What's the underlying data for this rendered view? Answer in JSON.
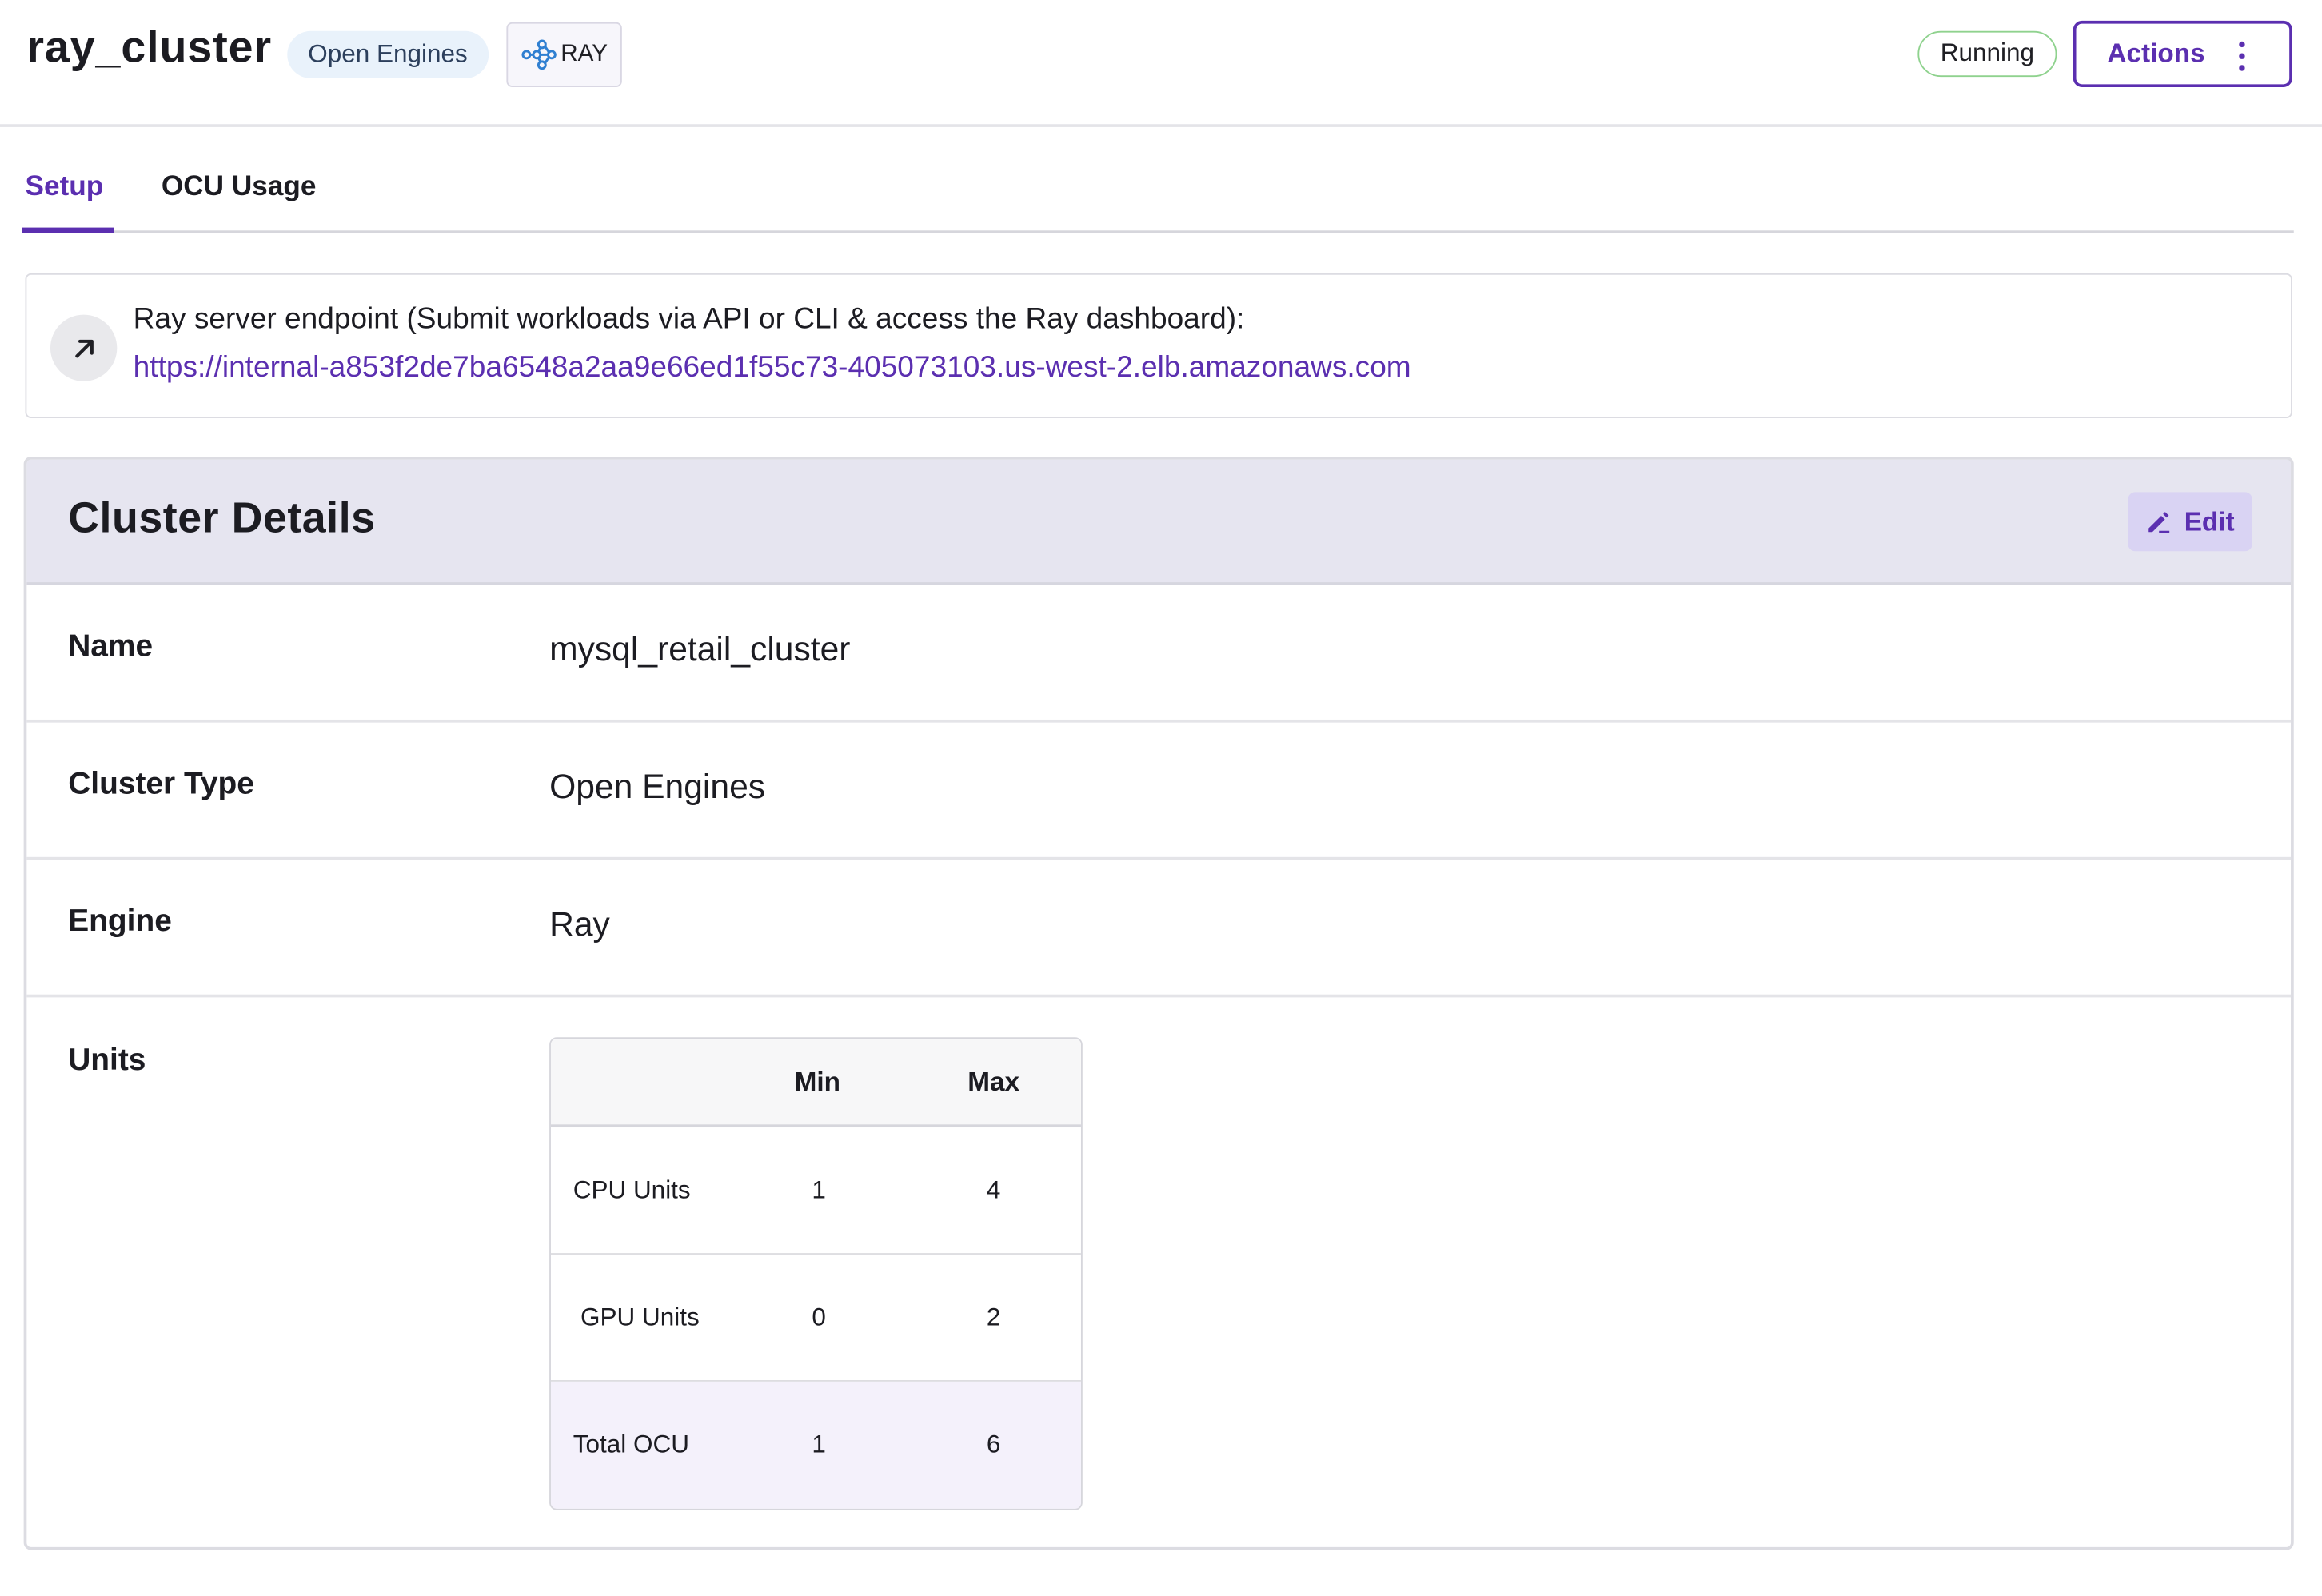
{
  "header": {
    "title": "ray_cluster",
    "cluster_type_badge": "Open Engines",
    "engine_badge": "RAY",
    "status": "Running",
    "actions_label": "Actions"
  },
  "tabs": [
    {
      "label": "Setup",
      "active": true
    },
    {
      "label": "OCU Usage",
      "active": false
    }
  ],
  "endpoint": {
    "label": "Ray server endpoint (Submit workloads via API or CLI & access the Ray dashboard):",
    "url": "https://internal-a853f2de7ba6548a2aa9e66ed1f55c73-405073103.us-west-2.elb.amazonaws.com"
  },
  "cluster_details": {
    "title": "Cluster Details",
    "edit_label": "Edit",
    "rows": [
      {
        "label": "Name",
        "value": "mysql_retail_cluster"
      },
      {
        "label": "Cluster Type",
        "value": "Open Engines"
      },
      {
        "label": "Engine",
        "value": "Ray"
      },
      {
        "label": "Units"
      }
    ]
  },
  "units_table": {
    "columns": [
      "",
      "Min",
      "Max"
    ],
    "rows": [
      {
        "label": "CPU Units",
        "min": "1",
        "max": "4"
      },
      {
        "label": "GPU Units",
        "min": "0",
        "max": "2"
      },
      {
        "label": "Total OCU",
        "min": "1",
        "max": "6"
      }
    ]
  },
  "colors": {
    "accent": "#5b2fb0",
    "status_border": "#8fd28e",
    "header_band": "#e6e5f0",
    "total_row": "#f4f1fb"
  },
  "icons": {
    "engine_badge": "ray-graph-icon",
    "endpoint": "arrow-up-right-icon",
    "edit": "pencil-icon",
    "actions": "kebab-menu-icon"
  }
}
